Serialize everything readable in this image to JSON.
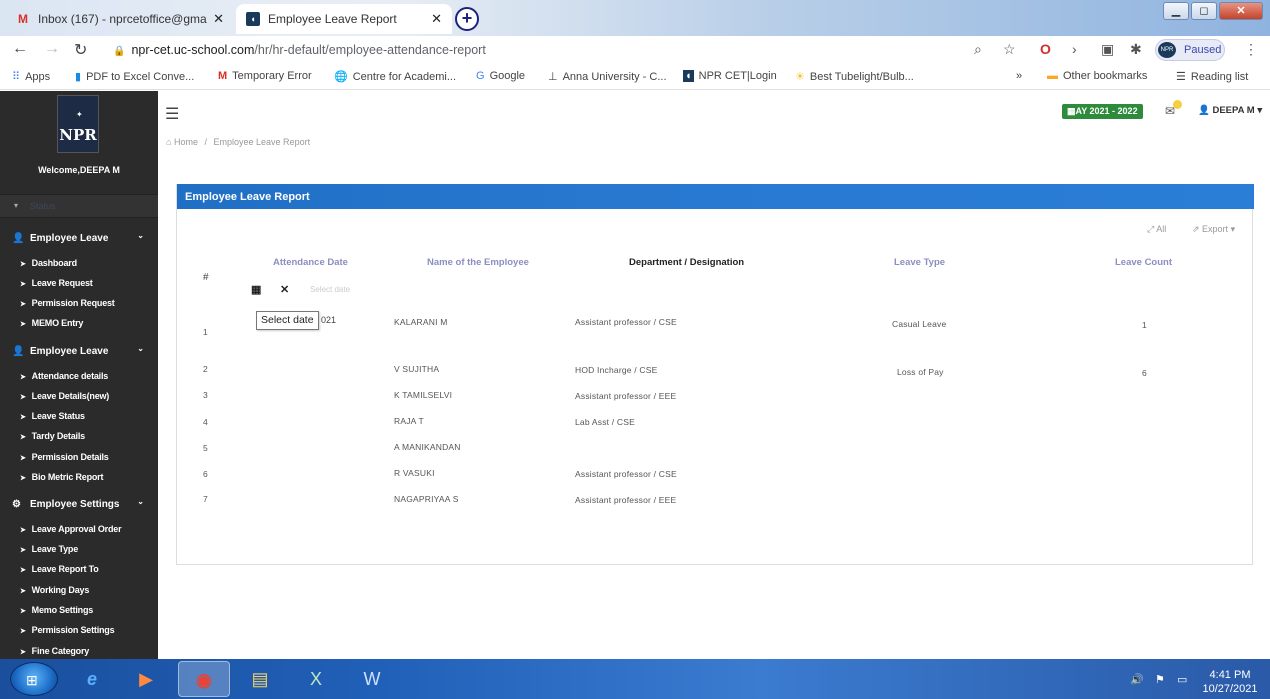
{
  "browser": {
    "tabs": [
      {
        "title": "Inbox (167) - nprcetoffice@gma",
        "icon": "gmail-icon"
      },
      {
        "title": "Employee Leave Report",
        "icon": "uc-school-icon"
      }
    ],
    "url_host": "npr-cet.uc-school.com",
    "url_path": "/hr/hr-default/employee-attendance-report",
    "profile_status": "Paused",
    "bookmarks": [
      "Apps",
      "PDF to Excel Conve...",
      "Temporary Error",
      "Centre for Academi...",
      "Google",
      "Anna University - C...",
      "NPR CET|Login",
      "Best Tubelight/Bulb...",
      "»",
      "Other bookmarks",
      "Reading list"
    ]
  },
  "sidebar": {
    "logo_text": "NPR",
    "welcome": "Welcome,DEEPA M",
    "status_label": "Status",
    "sections": [
      {
        "label": "Employee Leave",
        "items": [
          "Dashboard",
          "Leave Request",
          "Permission Request",
          "MEMO Entry"
        ]
      },
      {
        "label": "Employee Leave",
        "items": [
          "Attendance details",
          "Leave Details(new)",
          "Leave Status",
          "Tardy Details",
          "Permission Details",
          "Bio Metric Report"
        ]
      },
      {
        "label": "Employee Settings",
        "items": [
          "Leave Approval Order",
          "Leave Type",
          "Leave Report To",
          "Working Days",
          "Memo Settings",
          "Permission Settings",
          "Fine Category"
        ]
      }
    ]
  },
  "topbar": {
    "academic_year": "AY 2021 - 2022",
    "user_name": "DEEPA M"
  },
  "breadcrumb": {
    "home": "Home",
    "current": "Employee Leave Report"
  },
  "panel": {
    "title": "Employee Leave Report",
    "all_label": "All",
    "export_label": "Export",
    "columns": {
      "index": "#",
      "date": "Attendance Date",
      "name": "Name of the Employee",
      "dept": "Department / Designation",
      "type": "Leave Type",
      "count": "Leave Count"
    },
    "filter_placeholder": "Select date",
    "date_tooltip": "Select date",
    "date_partial": "021",
    "rows": [
      {
        "n": "1",
        "name": "KALARANI M",
        "dept": "Assistant professor / CSE",
        "type": "Casual Leave",
        "count": "1"
      },
      {
        "n": "2",
        "name": "V SUJITHA",
        "dept": "HOD Incharge / CSE",
        "type": "Loss of Pay",
        "count": "6"
      },
      {
        "n": "3",
        "name": "K TAMILSELVI",
        "dept": "Assistant professor / EEE",
        "type": "",
        "count": ""
      },
      {
        "n": "4",
        "name": "RAJA T",
        "dept": "Lab Asst / CSE",
        "type": "",
        "count": ""
      },
      {
        "n": "5",
        "name": "A MANIKANDAN",
        "dept": "",
        "type": "",
        "count": ""
      },
      {
        "n": "6",
        "name": "R VASUKI",
        "dept": "Assistant professor / CSE",
        "type": "",
        "count": ""
      },
      {
        "n": "7",
        "name": "NAGAPRIYAA S",
        "dept": "Assistant professor / EEE",
        "type": "",
        "count": ""
      }
    ]
  },
  "taskbar": {
    "time": "4:41 PM",
    "date": "10/27/2021"
  },
  "colors": {
    "panel_header": "#2878d0",
    "sidebar_bg": "#2b2b2b",
    "academic_year_badge": "#2e8b3c",
    "column_header": "#8a8fc0"
  }
}
